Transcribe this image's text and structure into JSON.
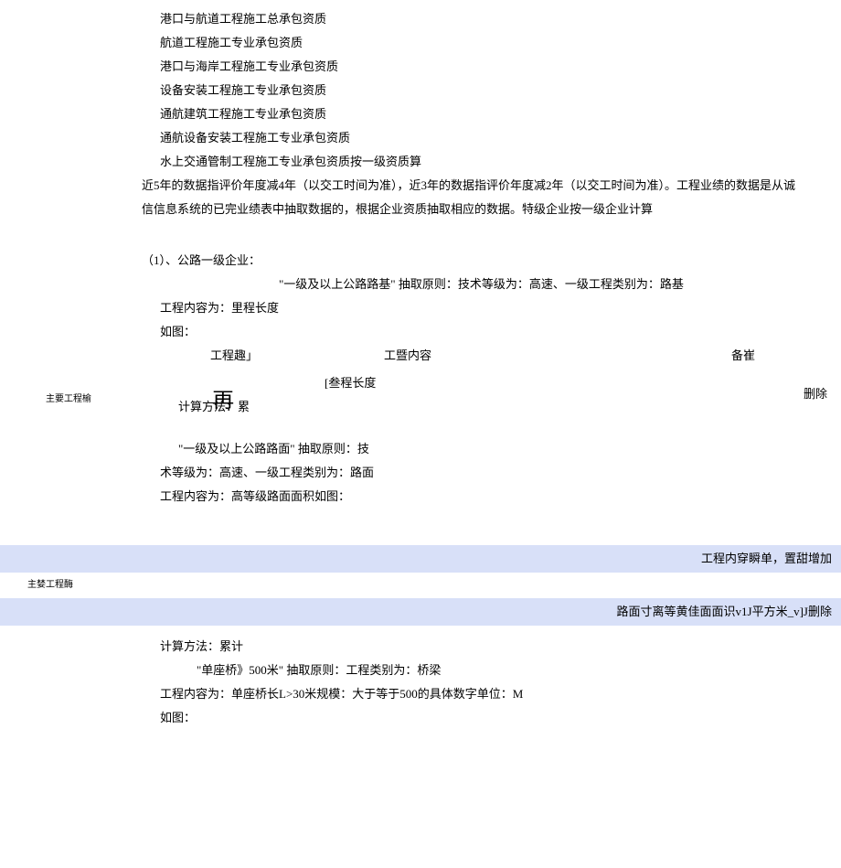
{
  "lines": {
    "l1": "港口与航道工程施工总承包资质",
    "l2": "航道工程施工专业承包资质",
    "l3": "港口与海岸工程施工专业承包资质",
    "l4": "设备安装工程施工专业承包资质",
    "l5": "通航建筑工程施工专业承包资质",
    "l6": "通航设备安装工程施工专业承包资质",
    "l7": "水上交通管制工程施工专业承包资质按一级资质算"
  },
  "para1": "近5年的数据指评价年度减4年（以交工时间为准），近3年的数据指评价年度减2年（以交工时间为准）。工程业绩的数据是从诚信信息系统的已完业绩表中抽取数据的，根据企业资质抽取相应的数据。特级企业按一级企业计算",
  "section1": {
    "title": "（1）、公路一级企业：",
    "p1": "\"一级及以上公路路基\" 抽取原则：技术等级为：高速、一级工程类别为：路基",
    "p2": "工程内容为：里程长度",
    "p3": "如图：",
    "th1": "工程趣」",
    "th2": "工暨内容",
    "th3": "备崔",
    "left_label": "主要工程榆",
    "row2": "[叁程长度",
    "del": "删除",
    "float_char": "再",
    "calc": "计算方法：累"
  },
  "section2": {
    "p1": "\"一级及以上公路路面\" 抽取原则：技",
    "p2": "术等级为：高速、一级工程类别为：路面",
    "p3": "工程内容为：高等级路面面积如图："
  },
  "blue": {
    "bar1": "工程内穿瞬单，置甜增加",
    "mid_label": "主婪工程酶",
    "bar2": "路面寸离等黄佳面面识v1J平方米_v]J删除"
  },
  "section3": {
    "calc": "计算方法：累计",
    "p1": "\"单座桥》500米\" 抽取原则：工程类别为：桥梁",
    "p2": "工程内容为：单座桥长L>30米规模：大于等于500的具体数字单位：M",
    "p3": "如图："
  }
}
